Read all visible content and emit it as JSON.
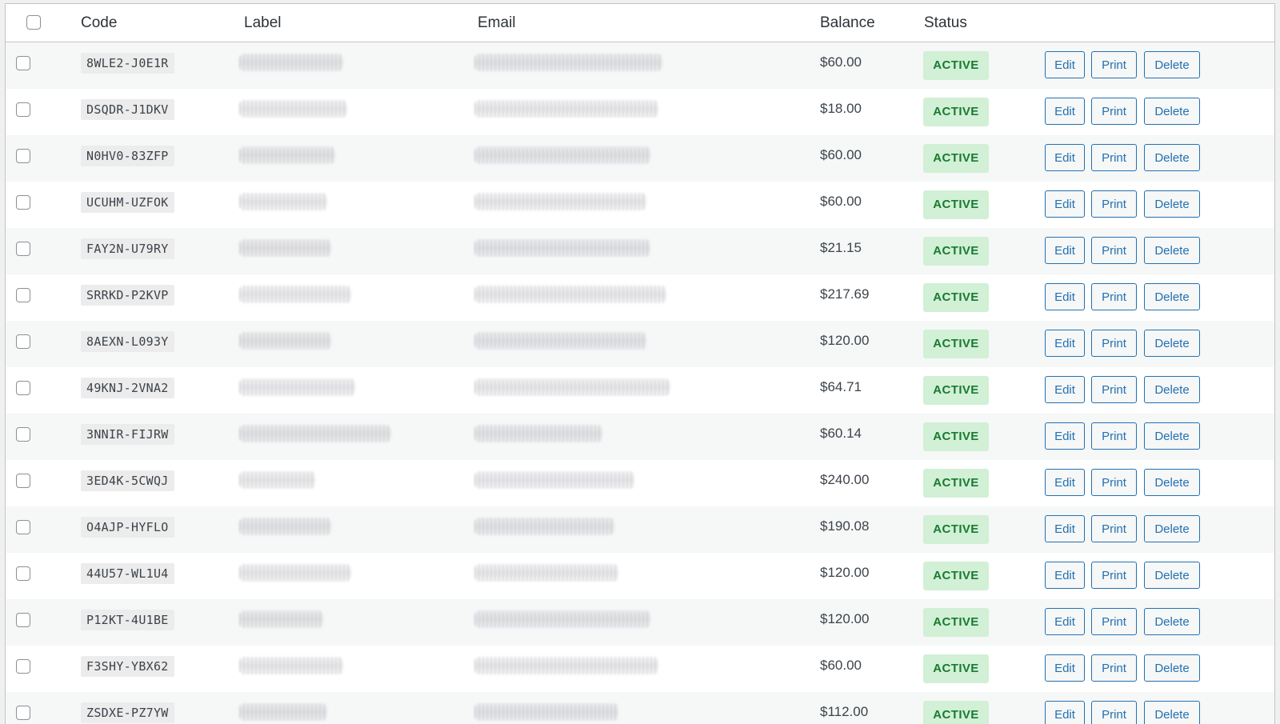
{
  "table": {
    "columns": {
      "code": "Code",
      "label": "Label",
      "email": "Email",
      "balance": "Balance",
      "status": "Status"
    },
    "actions": {
      "edit": "Edit",
      "print": "Print",
      "delete": "Delete"
    },
    "rows": [
      {
        "code": "8WLE2-J0E1R",
        "balance": "$60.00",
        "status": "ACTIVE"
      },
      {
        "code": "DSQDR-J1DKV",
        "balance": "$18.00",
        "status": "ACTIVE"
      },
      {
        "code": "N0HV0-83ZFP",
        "balance": "$60.00",
        "status": "ACTIVE"
      },
      {
        "code": "UCUHM-UZFOK",
        "balance": "$60.00",
        "status": "ACTIVE"
      },
      {
        "code": "FAY2N-U79RY",
        "balance": "$21.15",
        "status": "ACTIVE"
      },
      {
        "code": "SRRKD-P2KVP",
        "balance": "$217.69",
        "status": "ACTIVE"
      },
      {
        "code": "8AEXN-L093Y",
        "balance": "$120.00",
        "status": "ACTIVE"
      },
      {
        "code": "49KNJ-2VNA2",
        "balance": "$64.71",
        "status": "ACTIVE"
      },
      {
        "code": "3NNIR-FIJRW",
        "balance": "$60.14",
        "status": "ACTIVE"
      },
      {
        "code": "3ED4K-5CWQJ",
        "balance": "$240.00",
        "status": "ACTIVE"
      },
      {
        "code": "O4AJP-HYFLO",
        "balance": "$190.08",
        "status": "ACTIVE"
      },
      {
        "code": "44U57-WL1U4",
        "balance": "$120.00",
        "status": "ACTIVE"
      },
      {
        "code": "P12KT-4U1BE",
        "balance": "$120.00",
        "status": "ACTIVE"
      },
      {
        "code": "F3SHY-YBX62",
        "balance": "$60.00",
        "status": "ACTIVE"
      },
      {
        "code": "ZSDXE-PZ7YW",
        "balance": "$112.00",
        "status": "ACTIVE"
      }
    ]
  }
}
